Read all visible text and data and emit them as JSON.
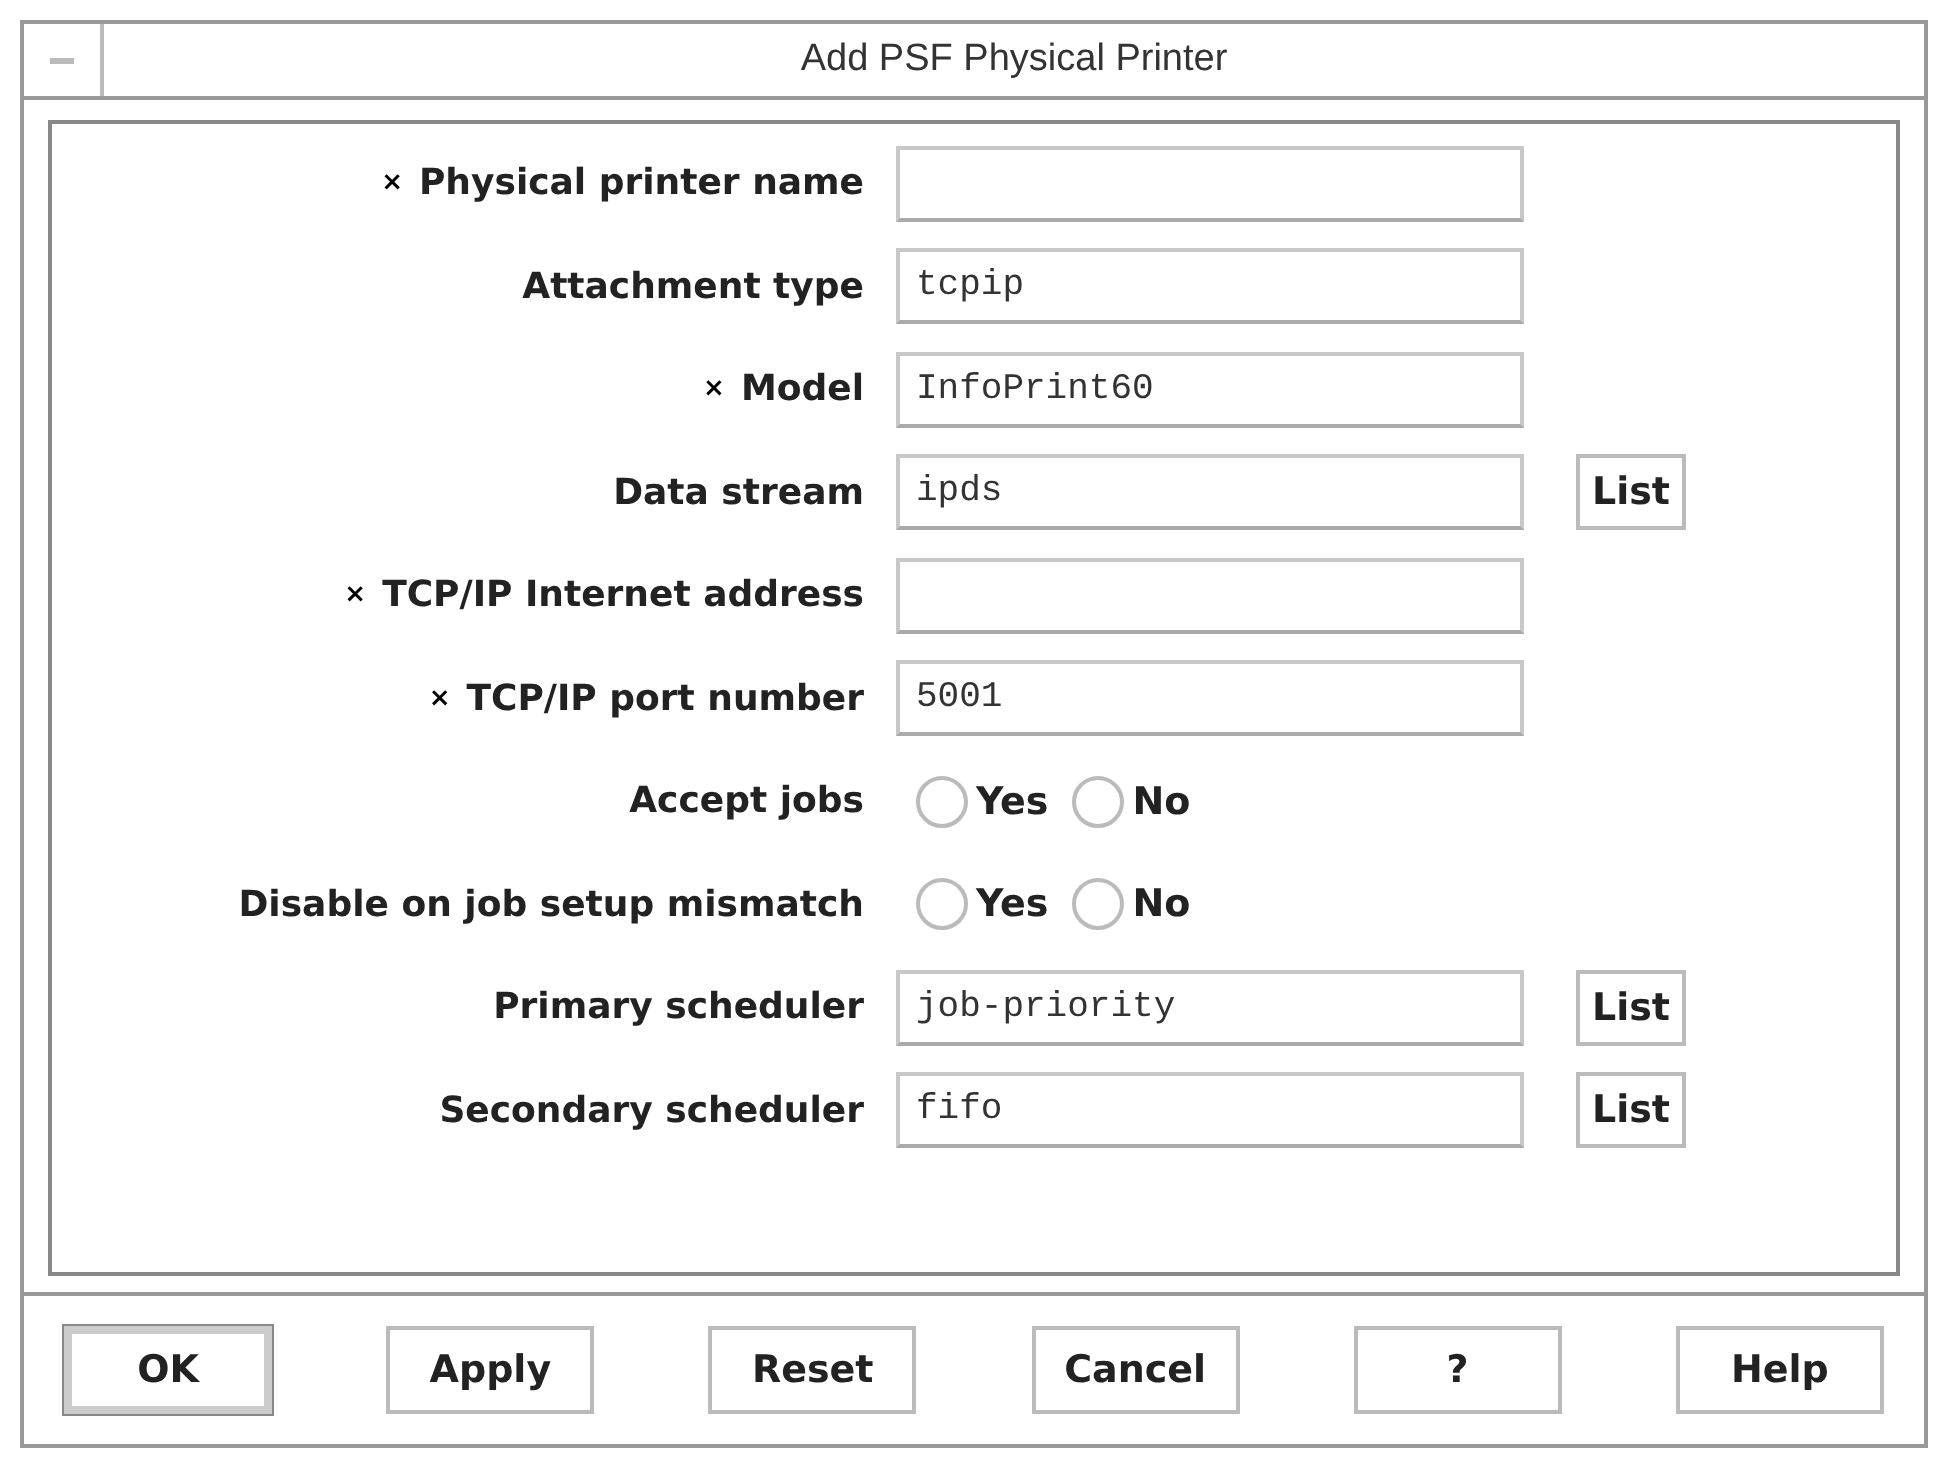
{
  "window": {
    "title": "Add PSF Physical Printer"
  },
  "fields": [
    {
      "kind": "text",
      "label": "Physical printer name",
      "required": true
    },
    {
      "kind": "text",
      "label": "Attachment type",
      "required": false,
      "value": "tcpip"
    },
    {
      "kind": "text",
      "label": "Model",
      "required": true,
      "value": "InfoPrint60"
    },
    {
      "kind": "text",
      "label": "Data stream",
      "required": false,
      "value": "ipds",
      "button": "List"
    },
    {
      "kind": "text",
      "label": "TCP/IP Internet address",
      "required": true
    },
    {
      "kind": "text",
      "label": "TCP/IP port number",
      "required": true,
      "value": "5001"
    },
    {
      "kind": "radio",
      "label": "Accept jobs",
      "required": false,
      "options": [
        {
          "label": "Yes",
          "selected": false
        },
        {
          "label": "No",
          "selected": false
        }
      ]
    },
    {
      "kind": "radio",
      "label": "Disable on job setup mismatch",
      "required": false,
      "options": [
        {
          "label": "Yes",
          "selected": false
        },
        {
          "label": "No",
          "selected": false
        }
      ]
    },
    {
      "kind": "text",
      "label": "Primary scheduler",
      "required": false,
      "value": "job-priority",
      "button": "List"
    },
    {
      "kind": "text",
      "label": "Secondary scheduler",
      "required": false,
      "value": "fifo",
      "button": "List"
    }
  ],
  "required_mark": "×",
  "buttons": [
    {
      "label": "OK",
      "default": true
    },
    {
      "label": "Apply",
      "default": false
    },
    {
      "label": "Reset",
      "default": false
    },
    {
      "label": "Cancel",
      "default": false
    },
    {
      "label": "?",
      "default": false
    },
    {
      "label": "Help",
      "default": false
    }
  ]
}
